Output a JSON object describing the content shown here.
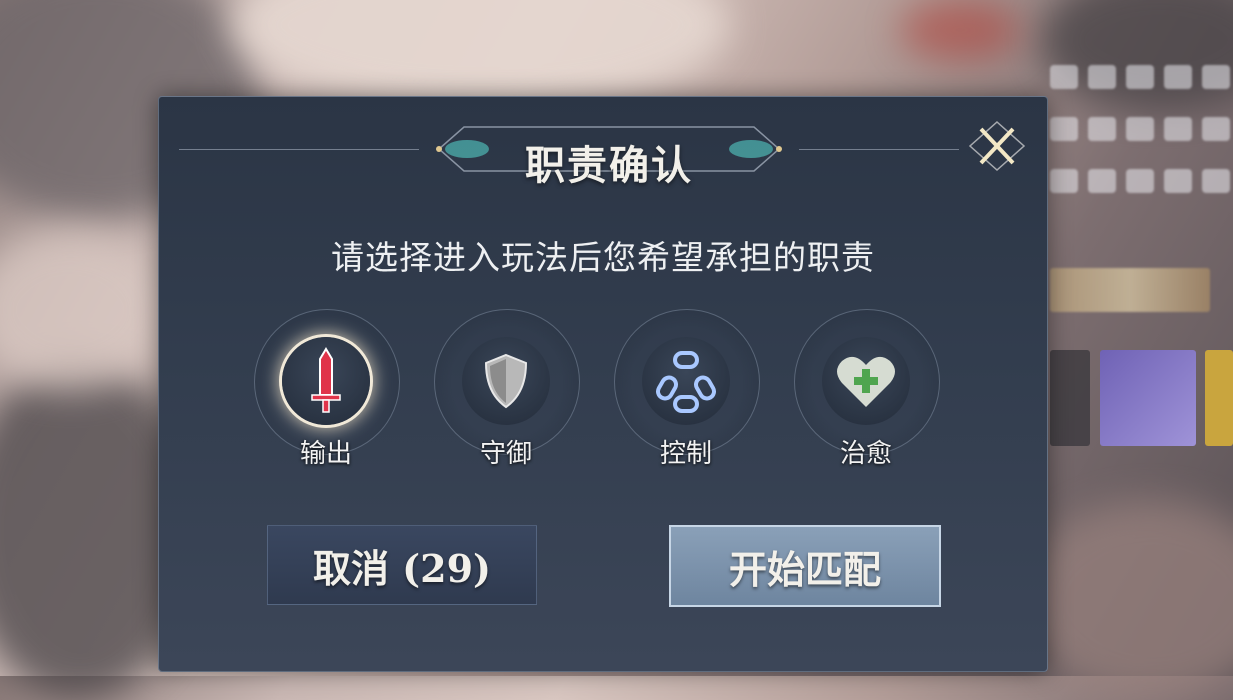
{
  "dialog": {
    "title": "职责确认",
    "prompt": "请选择进入玩法后您希望承担的职责",
    "close_icon": "close-x-icon",
    "roles": [
      {
        "label": "输出",
        "icon": "sword-icon",
        "selected": true,
        "color": "#e0344a"
      },
      {
        "label": "守御",
        "icon": "shield-icon",
        "selected": false,
        "color": "#b8b8b8"
      },
      {
        "label": "控制",
        "icon": "chain-icon",
        "selected": false,
        "color": "#7fb0ff"
      },
      {
        "label": "治愈",
        "icon": "heart-plus-icon",
        "selected": false,
        "color": "#5fae62"
      }
    ],
    "buttons": {
      "cancel_label": "取消 (29)",
      "match_label": "开始匹配"
    }
  }
}
